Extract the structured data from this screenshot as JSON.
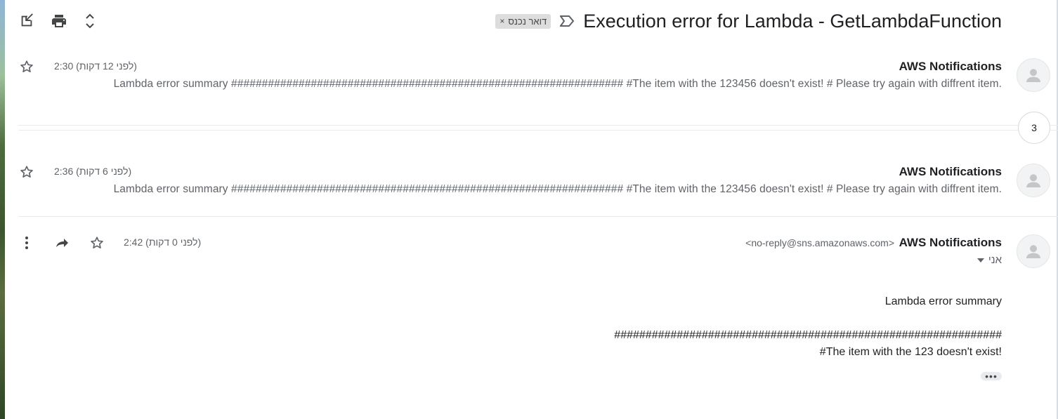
{
  "toolbar": {
    "icons": [
      "open-in-new-window-icon",
      "print-icon",
      "expand-collapse-icon"
    ]
  },
  "thread": {
    "subject": "Execution error for Lambda - GetLambdaFunction",
    "label": "דואר נכנס",
    "label_remove": "×",
    "collapsed_count": "3"
  },
  "messages": [
    {
      "sender": "AWS Notifications",
      "time": "2:30 (לפני 12 דקות)",
      "snippet": "Lambda error summary ################################################################ #The item with the 123456 doesn't exist! # Please try again with diffrent item."
    },
    {
      "sender": "AWS Notifications",
      "time": "2:36 (לפני 6 דקות)",
      "snippet": "Lambda error summary ################################################################ #The item with the 123456 doesn't exist! # Please try again with diffrent item."
    },
    {
      "sender": "AWS Notifications",
      "email": "<no-reply@sns.amazonaws.com>",
      "time": "2:42 (לפני 0 דקות)",
      "recipient": "אני",
      "body_line1": "Lambda error  summary",
      "body_line2": "##############################################################",
      "body_line3": "#The item with the 123 doesn't exist!",
      "trimmed_content": "•••"
    }
  ],
  "colors": {
    "text_primary": "#202124",
    "text_secondary": "#5f6368",
    "chip_bg": "#dddddd"
  }
}
